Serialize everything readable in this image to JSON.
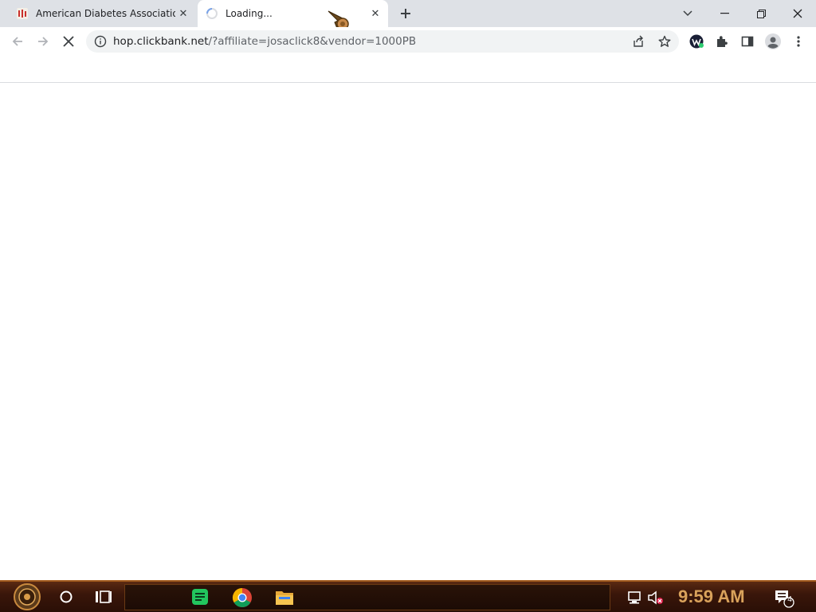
{
  "tabs": [
    {
      "title": "American Diabetes Association",
      "close_glyph": "✕",
      "favicon": "ada-favicon-icon"
    },
    {
      "title": "Loading...",
      "close_glyph": "✕",
      "favicon": "loading-spinner-icon"
    }
  ],
  "new_tab_icon": "plus-icon",
  "window_controls": [
    "chevron-down-icon",
    "minimize-icon",
    "restore-icon",
    "close-icon"
  ],
  "toolbar": {
    "url_host": "hop.clickbank.net",
    "url_rest": "/?affiliate=josaclick8&vendor=1000PB",
    "icons": [
      "back-icon",
      "forward-icon",
      "stop-loading-icon",
      "site-info-icon",
      "share-icon",
      "star-icon",
      "extension-w-icon",
      "puzzle-icon",
      "side-panel-icon",
      "profile-icon",
      "more-icon"
    ]
  },
  "taskbar": {
    "clock": "9:59 AM",
    "notification_count": "4",
    "accent": "#d9a25b",
    "icons": [
      "start-icon",
      "cortana-icon",
      "task-view-icon",
      "notes-app-icon",
      "chrome-icon",
      "file-explorer-icon",
      "network-icon",
      "volume-muted-icon",
      "notifications-icon"
    ]
  },
  "colors": {
    "tabbar": "#dee1e6",
    "omnibox": "#f1f3f4"
  }
}
